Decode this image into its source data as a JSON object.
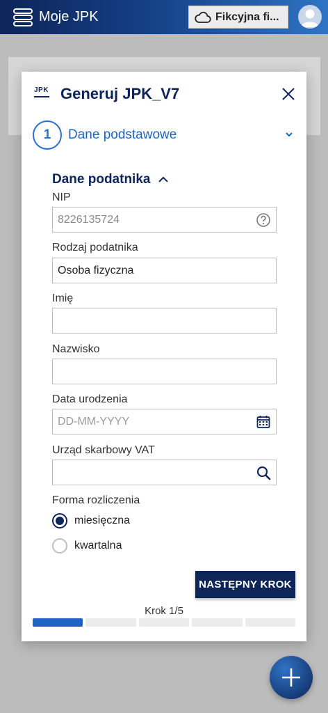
{
  "appbar": {
    "title": "Moje JPK",
    "company_label": "Fikcyjna fi...",
    "menu_icon": "menu-stack-icon",
    "company_icon": "cloud-icon",
    "avatar_icon": "user-avatar-icon"
  },
  "modal": {
    "logo_text": "JPK",
    "title": "Generuj JPK_V7",
    "step": {
      "number": "1",
      "title": "Dane podstawowe"
    },
    "section_title": "Dane podatnika",
    "fields": {
      "nip": {
        "label": "NIP",
        "value": "8226135724"
      },
      "rodzaj": {
        "label": "Rodzaj podatnika",
        "value": "Osoba fizyczna"
      },
      "imie": {
        "label": "Imię",
        "value": ""
      },
      "nazwisko": {
        "label": "Nazwisko",
        "value": ""
      },
      "data_urodzenia": {
        "label": "Data urodzenia",
        "placeholder": "DD-MM-YYYY"
      },
      "urzad": {
        "label": "Urząd skarbowy VAT",
        "value": ""
      }
    },
    "forma": {
      "label": "Forma rozliczenia",
      "options": [
        {
          "label": "miesięczna",
          "checked": true
        },
        {
          "label": "kwartalna",
          "checked": false
        }
      ]
    },
    "next_button": "NASTĘPNY KROK",
    "step_counter": "Krok 1/5",
    "progress": {
      "current": 1,
      "total": 5
    }
  },
  "colors": {
    "primary": "#0d2559",
    "accent": "#1f64c4"
  }
}
